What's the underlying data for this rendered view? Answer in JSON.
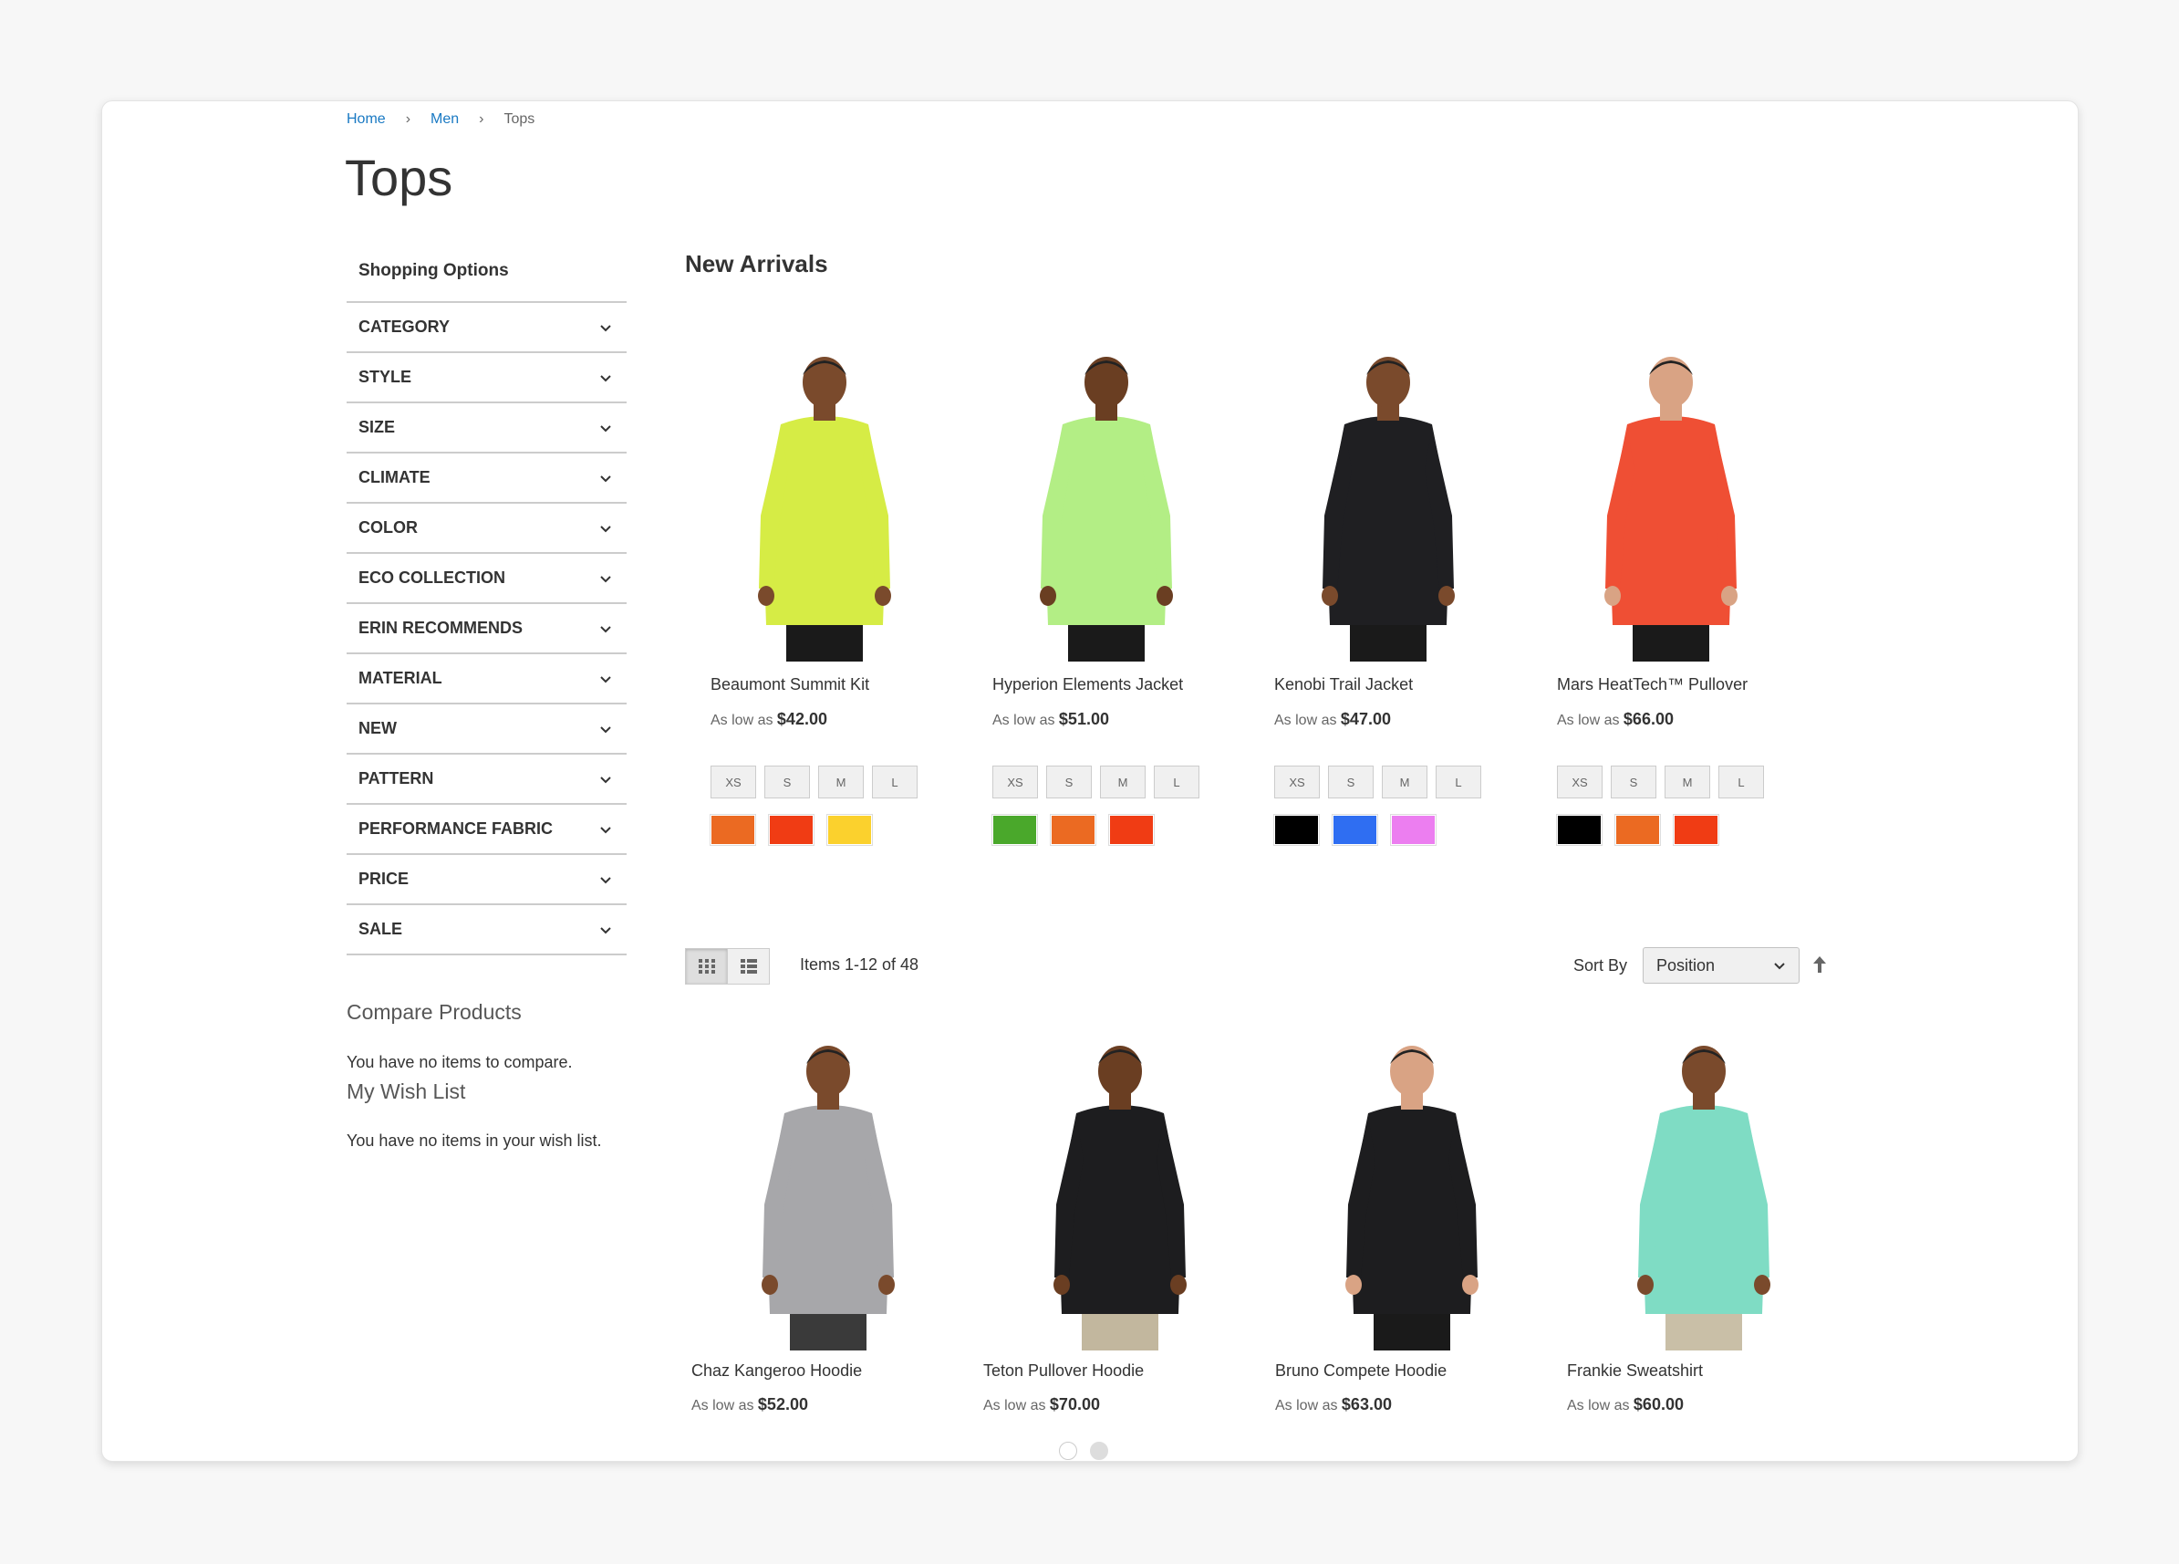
{
  "breadcrumb": {
    "home": "Home",
    "men": "Men",
    "current": "Tops"
  },
  "page_title": "Tops",
  "sidebar": {
    "title": "Shopping Options",
    "filters": [
      "CATEGORY",
      "STYLE",
      "SIZE",
      "CLIMATE",
      "COLOR",
      "ECO COLLECTION",
      "ERIN RECOMMENDS",
      "MATERIAL",
      "NEW",
      "PATTERN",
      "PERFORMANCE FABRIC",
      "PRICE",
      "SALE"
    ],
    "compare_title": "Compare Products",
    "compare_text": "You have no items to compare.",
    "wish_title": "My Wish List",
    "wish_text": "You have no items in your wish list."
  },
  "new_arrivals": {
    "title": "New Arrivals",
    "price_prefix": "As low as",
    "sizes": [
      "XS",
      "S",
      "M",
      "L"
    ],
    "products": [
      {
        "name": "Beaumont Summit Kit",
        "price": "$42.00",
        "shirt_color": "#d6ec45",
        "skin": "#7a4a2c",
        "swatches": [
          "#eb6a22",
          "#f03c14",
          "#fbd12d"
        ]
      },
      {
        "name": "Hyperion Elements Jacket",
        "price": "$51.00",
        "shirt_color": "#b3ee85",
        "skin": "#6a3e22",
        "swatches": [
          "#4aa82b",
          "#eb6a22",
          "#f03c14"
        ]
      },
      {
        "name": "Kenobi Trail Jacket",
        "price": "$47.00",
        "shirt_color": "#1f1f22",
        "skin": "#7a4a2c",
        "swatches": [
          "#000000",
          "#2f6ef2",
          "#ec7ef0"
        ]
      },
      {
        "name": "Mars HeatTech™ Pullover",
        "price": "$66.00",
        "shirt_color": "#ef4f34",
        "skin": "#d9a384",
        "swatches": [
          "#000000",
          "#eb6a22",
          "#f03c14"
        ]
      }
    ]
  },
  "toolbar": {
    "items": "Items 1-12 of 48",
    "sort_label": "Sort By",
    "sort_value": "Position"
  },
  "grid": {
    "price_prefix": "As low as",
    "products": [
      {
        "name": "Chaz Kangeroo Hoodie",
        "price": "$52.00",
        "shirt_color": "#a7a7aa",
        "skin": "#7a4a2c"
      },
      {
        "name": "Teton Pullover Hoodie",
        "price": "$70.00",
        "shirt_color": "#1d1d1f",
        "skin": "#6a3e22"
      },
      {
        "name": "Bruno Compete Hoodie",
        "price": "$63.00",
        "shirt_color": "#1d1d1f",
        "skin": "#d9a384"
      },
      {
        "name": "Frankie Sweatshirt",
        "price": "$60.00",
        "shirt_color": "#7fdcc4",
        "skin": "#7a4a2c"
      }
    ]
  },
  "icons": {
    "chevron": "chevron-down-icon",
    "grid": "grid-view-icon",
    "list": "list-view-icon",
    "sort": "arrow-up-icon"
  }
}
